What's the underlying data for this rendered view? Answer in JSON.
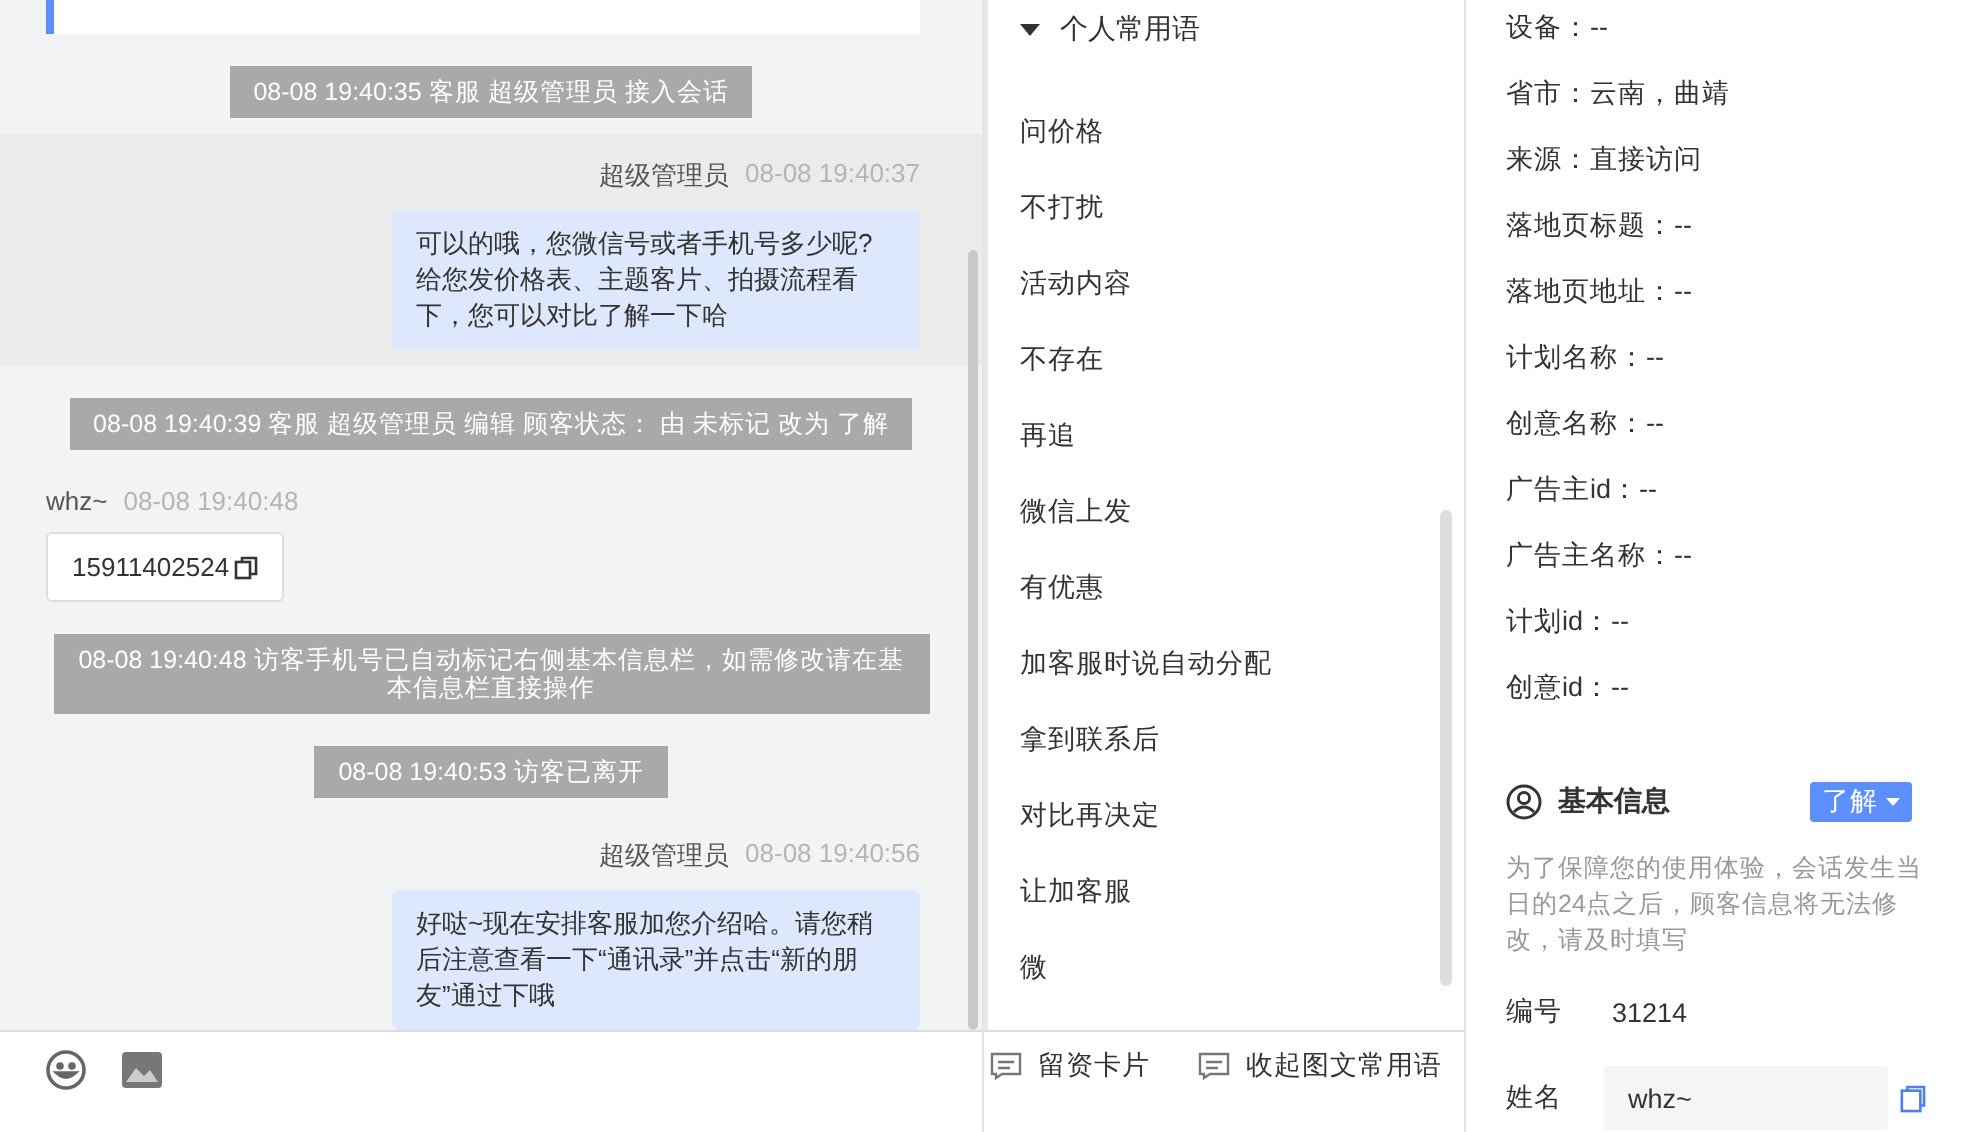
{
  "chat": {
    "messages": [
      {
        "kind": "system",
        "text": "08-08 19:40:35 客服 超级管理员 接入会话"
      },
      {
        "kind": "agent",
        "highlighted": true,
        "sender": "超级管理员",
        "time": "08-08 19:40:37",
        "text": "可以的哦，您微信号或者手机号多少呢?给您发价格表、主题客片、拍摄流程看下，您可以对比了解一下哈"
      },
      {
        "kind": "system",
        "text": "08-08 19:40:39 客服 超级管理员 编辑 顾客状态： 由 未标记 改为 了解"
      },
      {
        "kind": "visitor",
        "sender": "whz~",
        "time": "08-08 19:40:48",
        "text": "15911402524"
      },
      {
        "kind": "system",
        "text": "08-08 19:40:48 访客手机号已自动标记右侧基本信息栏，如需修改请在基本信息栏直接操作"
      },
      {
        "kind": "system",
        "text": "08-08 19:40:53 访客已离开"
      },
      {
        "kind": "agent",
        "highlighted": false,
        "sender": "超级管理员",
        "time": "08-08 19:40:56",
        "text": "好哒~现在安排客服加您介绍哈。请您稍后注意查看一下“通讯录”并点击“新的朋友”通过下哦"
      }
    ]
  },
  "phrases": {
    "title": "个人常用语",
    "expanded": true,
    "items": [
      "问价格",
      "不打扰",
      "活动内容",
      "不存在",
      "再追",
      "微信上发",
      "有优惠",
      "加客服时说自动分配",
      "拿到联系后",
      "对比再决定",
      "让加客服",
      "微"
    ],
    "actions": [
      "留资卡片",
      "收起图文常用语"
    ]
  },
  "info": {
    "fields": [
      "设备：--",
      "省市：云南，曲靖",
      "来源：直接访问",
      "落地页标题：--",
      "落地页地址：--",
      "计划名称：--",
      "创意名称：--",
      "广告主id：--",
      "广告主名称：--",
      "计划id：--",
      "创意id：--"
    ],
    "basic": {
      "title": "基本信息",
      "status": "了解",
      "note": "为了保障您的使用体验，会话发生当日的24点之后，顾客信息将无法修改，请及时填写",
      "number_label": "编号",
      "number": "31214",
      "name_label": "姓名",
      "name_value": "whz~"
    }
  }
}
